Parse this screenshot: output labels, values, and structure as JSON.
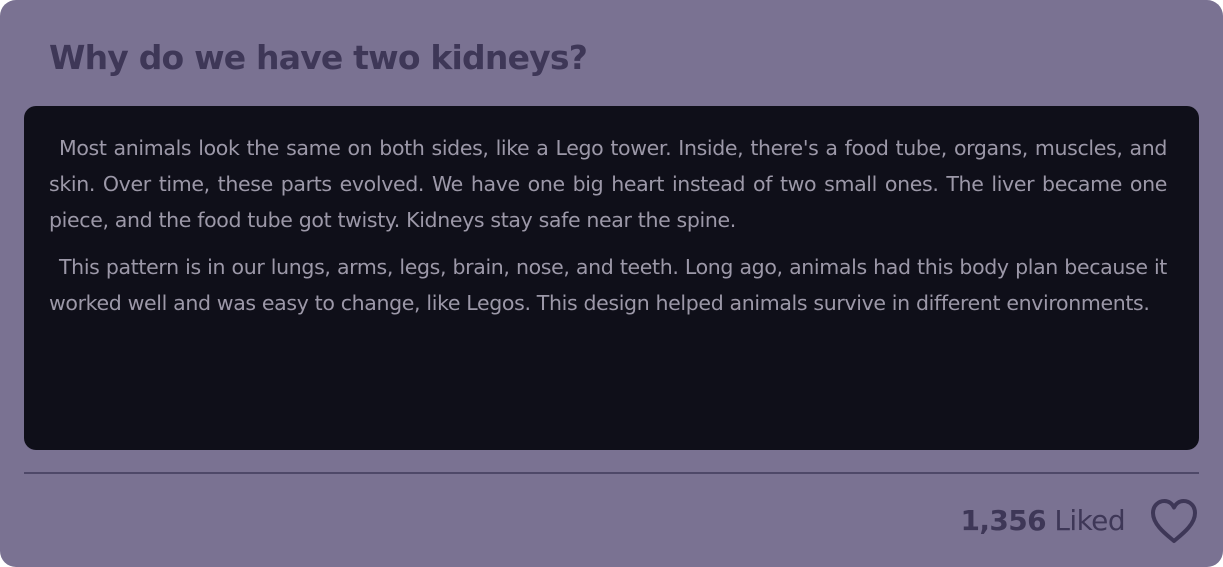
{
  "question": {
    "title": "Why do we have two kidneys?"
  },
  "answer": {
    "paragraphs": [
      "Most animals look the same on both sides, like a Lego tower. Inside, there's a food tube, organs, muscles, and skin. Over time, these parts evolved. We have one big heart instead of two small ones. The liver became one piece, and the food tube got twisty. Kidneys stay safe near the spine.",
      "This pattern is in our lungs, arms, legs, brain, nose, and teeth. Long ago, animals had this body plan because it worked well and was easy to change, like Legos. This design helped animals survive in different environments."
    ]
  },
  "footer": {
    "like_count": "1,356",
    "like_label": "Liked",
    "like_icon": "heart-outline-icon"
  },
  "colors": {
    "card_background": "#7a7292",
    "answer_background": "#0f0f19",
    "title_text": "#3e3757",
    "answer_text": "#9c98a8",
    "divider": "#4e4868"
  }
}
